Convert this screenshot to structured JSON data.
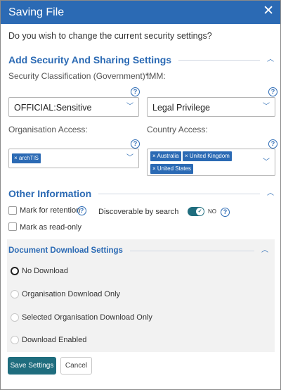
{
  "dialog": {
    "title": "Saving File",
    "close_symbol": "✕"
  },
  "question": "Do you wish to change the current security settings?",
  "security": {
    "heading": "Add Security And Sharing Settings",
    "classification_label": "Security Classification (Government)*:",
    "classification_value": "OFFICIAL:Sensitive",
    "imm_label": "IMM:",
    "imm_value": "Legal Privilege",
    "org_access_label": "Organisation Access:",
    "org_access_chips": [
      "archTIS"
    ],
    "country_access_label": "Country Access:",
    "country_access_chips": [
      "Australia",
      "United Kingdom",
      "United States"
    ],
    "chip_remove_symbol": "×",
    "help_symbol": "?"
  },
  "other": {
    "heading": "Other Information",
    "mark_retention": "Mark for retention",
    "discoverable_label": "Discoverable by search",
    "discoverable_state": "NO",
    "mark_readonly": "Mark as read-only"
  },
  "download": {
    "heading": "Document Download Settings",
    "options": [
      "No Download",
      "Organisation Download Only",
      "Selected Organisation Download Only",
      "Download Enabled"
    ],
    "selected_index": 0
  },
  "buttons": {
    "save": "Save Settings",
    "cancel": "Cancel"
  },
  "colors": {
    "accent": "#2b6ab4",
    "primary_button": "#1f6d7e"
  }
}
